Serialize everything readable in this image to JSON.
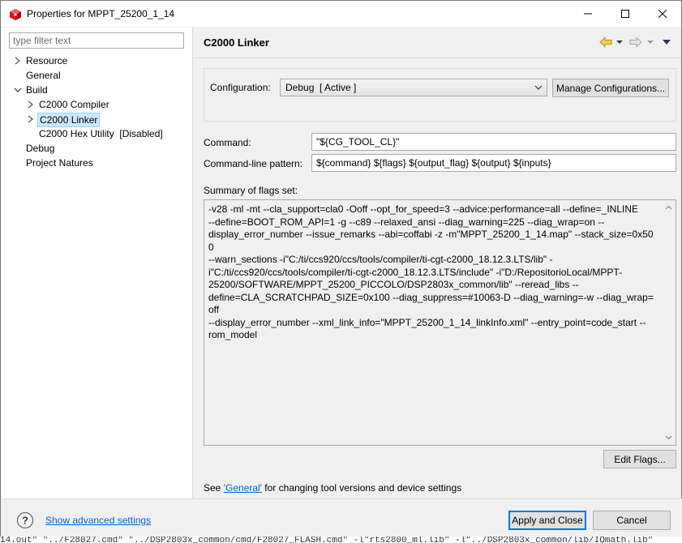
{
  "window": {
    "title": "Properties for MPPT_25200_1_14",
    "minimize_glyph": "—",
    "maximize_glyph": "☐",
    "close_glyph": "✕"
  },
  "left": {
    "filter_placeholder": "type filter text",
    "tree": [
      {
        "label": "Resource",
        "twisty": "collapsed"
      },
      {
        "label": "General",
        "twisty": "none"
      },
      {
        "label": "Build",
        "twisty": "expanded"
      },
      {
        "label": "C2000 Compiler",
        "twisty": "collapsed"
      },
      {
        "label": "C2000 Linker",
        "twisty": "collapsed",
        "selected": true
      },
      {
        "label": "C2000 Hex Utility  [Disabled]",
        "twisty": "none"
      },
      {
        "label": "Debug",
        "twisty": "none"
      },
      {
        "label": "Project Natures",
        "twisty": "none"
      }
    ]
  },
  "page": {
    "title": "C2000 Linker",
    "nav_icons": [
      "back-arrow-icon",
      "dropdown-icon",
      "forward-arrow-icon",
      "dropdown-icon",
      "view-menu-icon"
    ]
  },
  "config": {
    "label": "Configuration:",
    "value": "Debug  [ Active ]",
    "manage_button": "Manage Configurations..."
  },
  "command": {
    "label": "Command:",
    "value": "\"${CG_TOOL_CL}\""
  },
  "pattern": {
    "label": "Command-line pattern:",
    "value": "${command} ${flags} ${output_flag} ${output} ${inputs}"
  },
  "summary": {
    "label": "Summary of flags set:",
    "text": "-v28 -ml -mt --cla_support=cla0 -Ooff --opt_for_speed=3 --advice:performance=all --define=_INLINE --define=BOOT_ROM_API=1 -g --c89 --relaxed_ansi --diag_warning=225 --diag_wrap=on --display_error_number --issue_remarks --abi=coffabi -z -m\"MPPT_25200_1_14.map\" --stack_size=0x500 --warn_sections -i\"C:/ti/ccs920/ccs/tools/compiler/ti-cgt-c2000_18.12.3.LTS/lib\" -i\"C:/ti/ccs920/ccs/tools/compiler/ti-cgt-c2000_18.12.3.LTS/include\" -i\"D:/RepositorioLocal/MPPT-25200/SOFTWARE/MPPT_25200_PICCOLO/DSP2803x_common/lib\" --reread_libs --define=CLA_SCRATCHPAD_SIZE=0x100 --diag_suppress=#10063-D --diag_warning=-w --diag_wrap=off --display_error_number --xml_link_info=\"MPPT_25200_1_14_linkInfo.xml\" --entry_point=code_start --rom_model",
    "lines": [
      "-v28 -ml -mt --cla_support=cla0 -Ooff --opt_for_speed=3 --advice:performance=all --define=_INLINE",
      "--define=BOOT_ROM_API=1 -g --c89 --relaxed_ansi --diag_warning=225 --diag_wrap=on --",
      "display_error_number --issue_remarks --abi=coffabi -z -m\"MPPT_25200_1_14.map\" --stack_size=0x500",
      "--warn_sections -i\"C:/ti/ccs920/ccs/tools/compiler/ti-cgt-c2000_18.12.3.LTS/lib\" -",
      "i\"C:/ti/ccs920/ccs/tools/compiler/ti-cgt-c2000_18.12.3.LTS/include\" -i\"D:/RepositorioLocal/MPPT-",
      "25200/SOFTWARE/MPPT_25200_PICCOLO/DSP2803x_common/lib\" --reread_libs --",
      "define=CLA_SCRATCHPAD_SIZE=0x100 --diag_suppress=#10063-D --diag_warning=-w --diag_wrap=off",
      "--display_error_number --xml_link_info=\"MPPT_25200_1_14_linkInfo.xml\" --entry_point=code_start --",
      "rom_model"
    ],
    "edit_flags_button": "Edit Flags..."
  },
  "footer_note": {
    "prefix": "See ",
    "link": "'General'",
    "suffix": " for changing tool versions and device settings"
  },
  "bottom": {
    "help_glyph": "?",
    "advanced_link": "Show advanced settings",
    "apply_close": "Apply and Close",
    "cancel": "Cancel"
  },
  "background_text": "14.out\" \"../F28027.cmd\" \"../DSP2803x_common/cmd/F28027_FLASH.cmd\" -l\"rts2800_ml.lib\" -l\"../DSP2803x_common/lib/IQmath.lib\""
}
